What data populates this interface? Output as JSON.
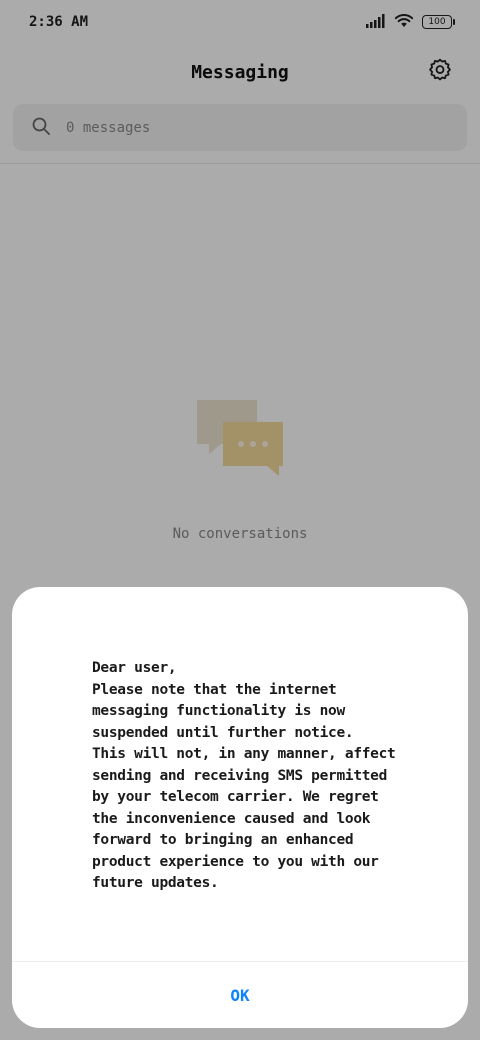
{
  "status_bar": {
    "time": "2:36 AM",
    "battery": "100",
    "icons": [
      "signal-icon",
      "wifi-icon",
      "battery-icon"
    ]
  },
  "header": {
    "title": "Messaging",
    "settings_icon": "gear-icon"
  },
  "search": {
    "placeholder": "0 messages",
    "icon": "search-icon"
  },
  "empty_state": {
    "icon": "chat-bubbles-icon",
    "text": "No conversations"
  },
  "dialog": {
    "message": "Dear user,\nPlease note that the internet\nmessaging functionality is now\nsuspended until further notice.\nThis will not, in any manner, affect\nsending and receiving SMS permitted\nby your telecom carrier. We regret\nthe inconvenience caused and look\nforward to bringing an enhanced\nproduct experience to you with our\nfuture updates.",
    "ok_label": "OK"
  },
  "colors": {
    "accent": "#0d84ff",
    "scrim": "rgba(0,0,0,0.33)",
    "empty_icon_front": "#f3d99b",
    "empty_icon_back": "#ece4d0"
  }
}
